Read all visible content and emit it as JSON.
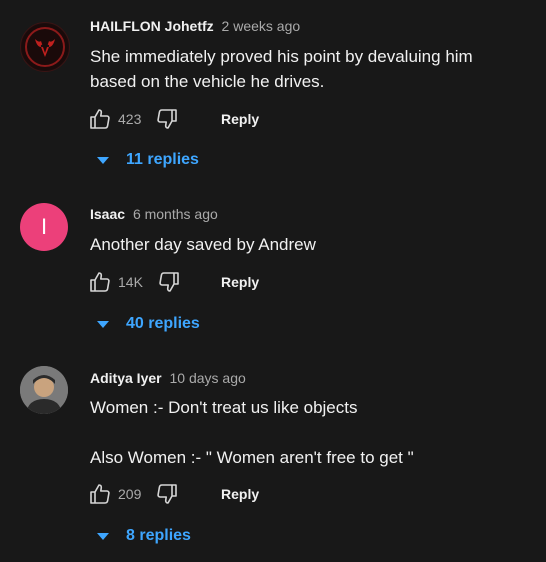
{
  "comments": [
    {
      "author": "HAILFLON Johetfz",
      "time": "2 weeks ago",
      "lines": [
        "She immediately proved his point by devaluing him",
        "based on the vehicle he drives."
      ],
      "likes": "423",
      "reply_label": "Reply",
      "replies_label": "11 replies"
    },
    {
      "author": "Isaac",
      "avatar_letter": "I",
      "time": "6 months ago",
      "lines": [
        "Another day saved by Andrew"
      ],
      "likes": "14K",
      "reply_label": "Reply",
      "replies_label": "40 replies"
    },
    {
      "author": "Aditya Iyer",
      "time": "10 days ago",
      "lines": [
        "Women :- Don't treat us like objects",
        "Also Women :- \" Women aren't free to get \""
      ],
      "likes": "209",
      "reply_label": "Reply",
      "replies_label": "8 replies"
    }
  ],
  "colors": {
    "background": "#181818",
    "link": "#3ea6ff",
    "letter_avatar": "#ec407a"
  }
}
